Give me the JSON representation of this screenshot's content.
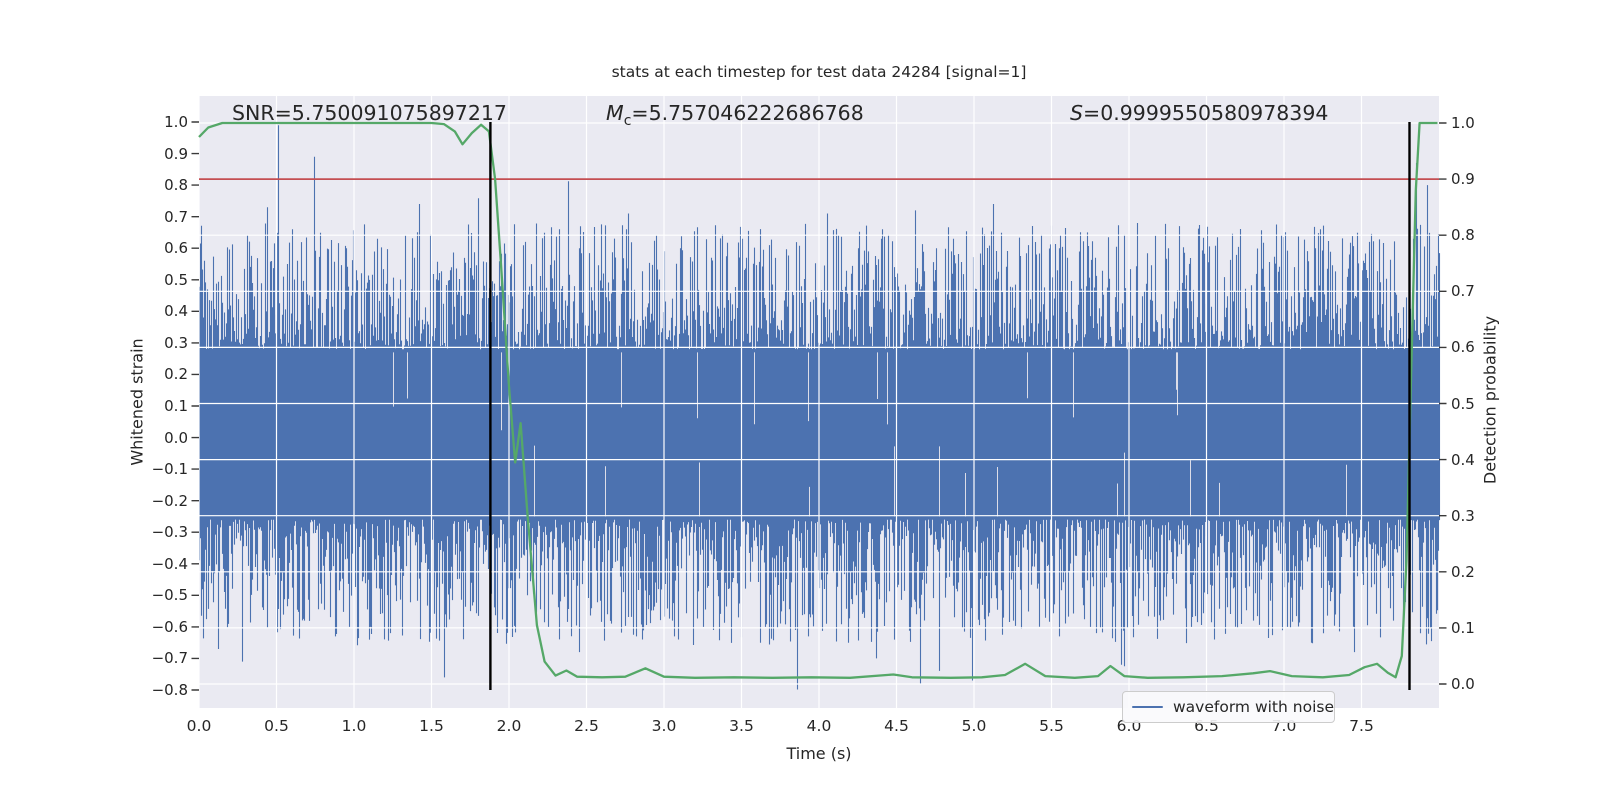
{
  "chart_data": {
    "type": "line",
    "title": "stats at each timestep for test data 24284 [signal=1]",
    "xlabel": "Time (s)",
    "ylabel_left": "Whitened strain",
    "ylabel_right": "Detection probability",
    "xlim": [
      0.0,
      8.0
    ],
    "ylim_left": [
      -0.86,
      1.08
    ],
    "ylim_right": [
      -0.045,
      1.05
    ],
    "x_ticks": [
      0.0,
      0.5,
      1.0,
      1.5,
      2.0,
      2.5,
      3.0,
      3.5,
      4.0,
      4.5,
      5.0,
      5.5,
      6.0,
      6.5,
      7.0,
      7.5
    ],
    "y_ticks_left": [
      1.0,
      0.9,
      0.8,
      0.7,
      0.6,
      0.5,
      0.4,
      0.3,
      0.2,
      0.1,
      0.0,
      -0.1,
      -0.2,
      -0.3,
      -0.4,
      -0.5,
      -0.6,
      -0.7,
      -0.8
    ],
    "y_ticks_right": [
      1.0,
      0.9,
      0.8,
      0.7,
      0.6,
      0.5,
      0.4,
      0.3,
      0.2,
      0.1,
      0.0
    ],
    "grid": {
      "show": true,
      "color": "#ffffff",
      "vertical_at": "x_ticks",
      "horizontal_at": "y_ticks_right"
    },
    "background": {
      "figure": "#ffffff",
      "axes": "#EAEAF2"
    },
    "annotations": [
      {
        "label": "SNR",
        "italic": false,
        "sub": "",
        "value": "=5.750091075897217"
      },
      {
        "label": "M",
        "italic": true,
        "sub": "c",
        "value": "=5.757046222686768"
      },
      {
        "label": "S",
        "italic": true,
        "sub": "",
        "value": "=0.9999550580978394"
      }
    ],
    "legend": {
      "label": "waveform with noise",
      "location": "lower right"
    },
    "series": [
      {
        "name": "waveform with noise",
        "kind": "noise-band",
        "axis": "left",
        "color": "#4C72B0",
        "core_band": [
          -0.26,
          0.28
        ],
        "typical_peak": 0.55,
        "pos_spikes": [
          [
            0.03,
            0.56
          ],
          [
            0.44,
            0.73
          ],
          [
            0.51,
            0.99
          ],
          [
            0.58,
            0.52
          ],
          [
            0.74,
            0.89
          ],
          [
            0.95,
            0.6
          ],
          [
            1.15,
            0.63
          ],
          [
            1.33,
            0.64
          ],
          [
            1.42,
            0.74
          ],
          [
            1.62,
            0.52
          ],
          [
            1.88,
            0.55
          ],
          [
            2.1,
            0.62
          ],
          [
            2.32,
            0.66
          ],
          [
            2.45,
            0.6
          ],
          [
            2.62,
            0.58
          ],
          [
            2.77,
            0.71
          ],
          [
            2.95,
            0.64
          ],
          [
            3.1,
            0.6
          ],
          [
            3.3,
            0.57
          ],
          [
            3.5,
            0.63
          ],
          [
            3.68,
            0.61
          ],
          [
            3.85,
            0.58
          ],
          [
            4.05,
            0.71
          ],
          [
            4.25,
            0.6
          ],
          [
            4.4,
            0.63
          ],
          [
            4.62,
            0.72
          ],
          [
            4.85,
            0.59
          ],
          [
            5.12,
            0.74
          ],
          [
            5.35,
            0.61
          ],
          [
            5.55,
            0.6
          ],
          [
            5.78,
            0.57
          ],
          [
            6.05,
            0.68
          ],
          [
            6.25,
            0.6
          ],
          [
            6.45,
            0.63
          ],
          [
            6.7,
            0.59
          ],
          [
            6.98,
            0.62
          ],
          [
            7.2,
            0.6
          ],
          [
            7.42,
            0.58
          ],
          [
            7.55,
            0.62
          ],
          [
            7.85,
            0.87
          ],
          [
            7.92,
            0.8
          ]
        ],
        "neg_spikes": [
          [
            0.12,
            -0.67
          ],
          [
            0.28,
            -0.71
          ],
          [
            0.5,
            -0.55
          ],
          [
            0.68,
            -0.58
          ],
          [
            0.88,
            -0.63
          ],
          [
            0.97,
            -0.6
          ],
          [
            1.1,
            -0.6
          ],
          [
            1.58,
            -0.76
          ],
          [
            1.75,
            -0.55
          ],
          [
            2.02,
            -0.58
          ],
          [
            2.25,
            -0.6
          ],
          [
            2.45,
            -0.68
          ],
          [
            2.63,
            -0.56
          ],
          [
            2.86,
            -0.64
          ],
          [
            3.05,
            -0.58
          ],
          [
            3.25,
            -0.6
          ],
          [
            3.48,
            -0.57
          ],
          [
            3.65,
            -0.6
          ],
          [
            3.9,
            -0.56
          ],
          [
            4.19,
            -0.65
          ],
          [
            4.37,
            -0.7
          ],
          [
            4.65,
            -0.78
          ],
          [
            4.99,
            -0.77
          ],
          [
            5.25,
            -0.58
          ],
          [
            5.55,
            -0.63
          ],
          [
            5.75,
            -0.6
          ],
          [
            5.95,
            -0.72
          ],
          [
            6.2,
            -0.58
          ],
          [
            6.4,
            -0.6
          ],
          [
            6.55,
            -0.64
          ],
          [
            6.8,
            -0.58
          ],
          [
            7.02,
            -0.6
          ],
          [
            7.25,
            -0.62
          ],
          [
            7.45,
            -0.68
          ],
          [
            7.7,
            -0.58
          ],
          [
            7.88,
            -0.62
          ]
        ]
      },
      {
        "name": "detection probability",
        "kind": "line",
        "axis": "right",
        "color": "#55A868",
        "points": [
          [
            0.0,
            0.975
          ],
          [
            0.06,
            0.992
          ],
          [
            0.15,
            1.0
          ],
          [
            0.6,
            1.0
          ],
          [
            1.0,
            1.0
          ],
          [
            1.5,
            1.0
          ],
          [
            1.58,
            0.998
          ],
          [
            1.65,
            0.985
          ],
          [
            1.7,
            0.962
          ],
          [
            1.76,
            0.982
          ],
          [
            1.82,
            0.997
          ],
          [
            1.87,
            0.985
          ],
          [
            1.91,
            0.9
          ],
          [
            1.95,
            0.74
          ],
          [
            2.0,
            0.53
          ],
          [
            2.04,
            0.395
          ],
          [
            2.075,
            0.465
          ],
          [
            2.12,
            0.3
          ],
          [
            2.18,
            0.105
          ],
          [
            2.23,
            0.04
          ],
          [
            2.3,
            0.015
          ],
          [
            2.37,
            0.024
          ],
          [
            2.44,
            0.013
          ],
          [
            2.6,
            0.012
          ],
          [
            2.75,
            0.013
          ],
          [
            2.88,
            0.028
          ],
          [
            3.0,
            0.013
          ],
          [
            3.2,
            0.011
          ],
          [
            3.45,
            0.012
          ],
          [
            3.7,
            0.011
          ],
          [
            3.95,
            0.012
          ],
          [
            4.2,
            0.011
          ],
          [
            4.48,
            0.017
          ],
          [
            4.6,
            0.012
          ],
          [
            4.85,
            0.011
          ],
          [
            5.05,
            0.012
          ],
          [
            5.2,
            0.016
          ],
          [
            5.33,
            0.036
          ],
          [
            5.46,
            0.014
          ],
          [
            5.65,
            0.011
          ],
          [
            5.8,
            0.014
          ],
          [
            5.88,
            0.032
          ],
          [
            5.97,
            0.014
          ],
          [
            6.12,
            0.011
          ],
          [
            6.35,
            0.012
          ],
          [
            6.6,
            0.014
          ],
          [
            6.8,
            0.019
          ],
          [
            6.91,
            0.023
          ],
          [
            7.05,
            0.014
          ],
          [
            7.25,
            0.012
          ],
          [
            7.42,
            0.016
          ],
          [
            7.52,
            0.03
          ],
          [
            7.6,
            0.036
          ],
          [
            7.67,
            0.02
          ],
          [
            7.72,
            0.012
          ],
          [
            7.76,
            0.05
          ],
          [
            7.79,
            0.22
          ],
          [
            7.82,
            0.55
          ],
          [
            7.85,
            0.88
          ],
          [
            7.875,
            1.0
          ],
          [
            7.99,
            1.0
          ]
        ]
      },
      {
        "name": "detection threshold",
        "kind": "hline",
        "axis": "right",
        "color": "#C44E52",
        "y": 0.9
      },
      {
        "name": "signal window markers",
        "kind": "vlines",
        "axis": "left",
        "color": "#000000",
        "x": [
          1.88,
          7.81
        ],
        "yspan": [
          -0.8,
          1.0
        ]
      }
    ]
  }
}
